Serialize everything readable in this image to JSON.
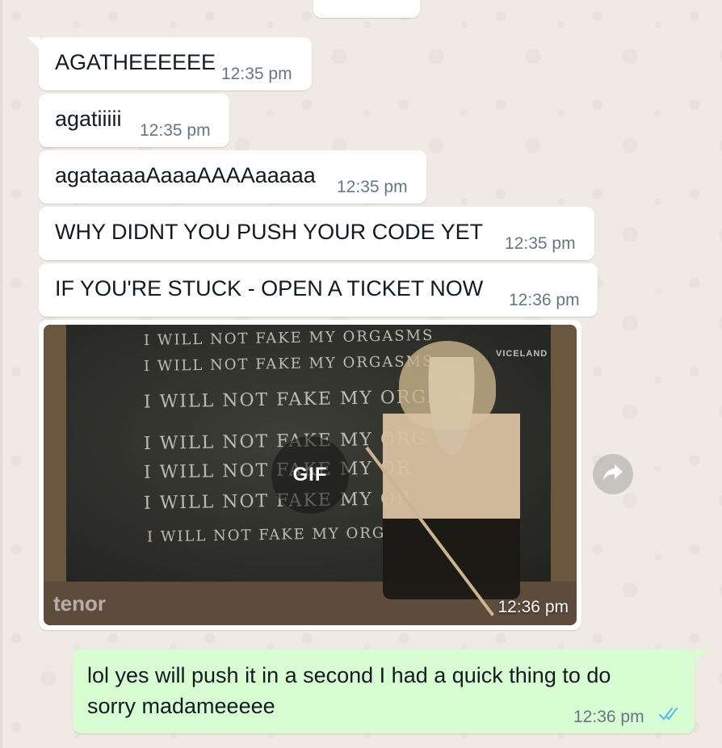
{
  "messages_in": [
    {
      "text": "AGATHEEEEEE",
      "time": "12:35 pm"
    },
    {
      "text": "agatiiiii",
      "time": "12:35 pm"
    },
    {
      "text": "agataaaaAaaaAAAAaaaaa",
      "time": "12:35 pm"
    },
    {
      "text": "WHY DIDNT YOU PUSH YOUR CODE YET",
      "time": "12:35 pm"
    },
    {
      "text": "IF YOU'RE STUCK - OPEN A TICKET NOW",
      "time": "12:36 pm"
    }
  ],
  "gif_message": {
    "badge": "GIF",
    "watermark": "tenor",
    "channel_logo": "VICELAND",
    "chalk_lines": [
      "I WILL NOT FAKE MY ORGASMS",
      "I WILL NOT FAKE MY ORGASMS",
      "I WILL NOT FAKE MY ORGASM",
      "I WILL NOT FAKE MY ORG",
      "I WILL NOT FAKE MY OR",
      "I WILL NOT FAKE MY OR",
      "I WILL NOT FAKE MY ORG"
    ],
    "time": "12:36 pm",
    "forward_icon": "forward-icon"
  },
  "message_out": {
    "line1": "lol yes will push it in a second I had a quick thing to do",
    "line2": "sorry madameeeee",
    "time": "12:36 pm",
    "status_icon": "double-check-read-icon"
  },
  "colors": {
    "background": "#efeae2",
    "incoming_bubble": "#ffffff",
    "outgoing_bubble": "#d9fdd3",
    "timestamp": "#667781",
    "read_ticks": "#53bdeb"
  }
}
